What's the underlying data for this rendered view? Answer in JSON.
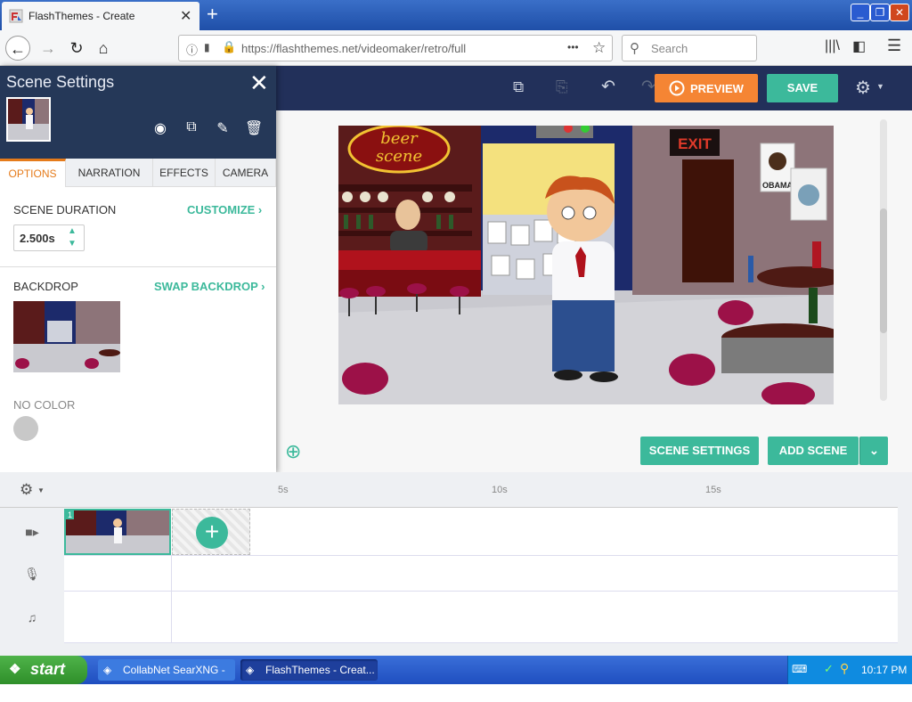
{
  "browser": {
    "tab_title": "FlashThemes - Create",
    "url": "https://flashthemes.net/videomaker/retro/full",
    "search_placeholder": "Search",
    "new_tab": "+",
    "more": "•••"
  },
  "toolbar": {
    "preview_label": "PREVIEW",
    "save_label": "SAVE"
  },
  "panel": {
    "title": "Scene Settings",
    "tabs": [
      "OPTIONS",
      "NARRATION",
      "EFFECTS",
      "CAMERA"
    ],
    "duration_label": "SCENE DURATION",
    "customize_label": "CUSTOMIZE ›",
    "duration_value": "2.500s",
    "backdrop_label": "BACKDROP",
    "swap_label": "SWAP BACKDROP ›",
    "color_label": "NO COLOR"
  },
  "stage": {
    "scene_settings_label": "SCENE SETTINGS",
    "add_scene_label": "ADD SCENE",
    "sign_beer": "beer",
    "sign_scene": "scene",
    "exit_sign": "EXIT",
    "poster_text": "OBAMA"
  },
  "timeline": {
    "ticks": [
      "5s",
      "10s",
      "15s"
    ],
    "scene_number": "1"
  },
  "taskbar": {
    "start_label": "start",
    "task1": "CollabNet SearXNG - ...",
    "task2": "FlashThemes - Creat...",
    "clock": "10:17 PM"
  },
  "colors": {
    "accent_green": "#3cb99b",
    "accent_orange": "#f58534",
    "header_navy": "#253858"
  }
}
